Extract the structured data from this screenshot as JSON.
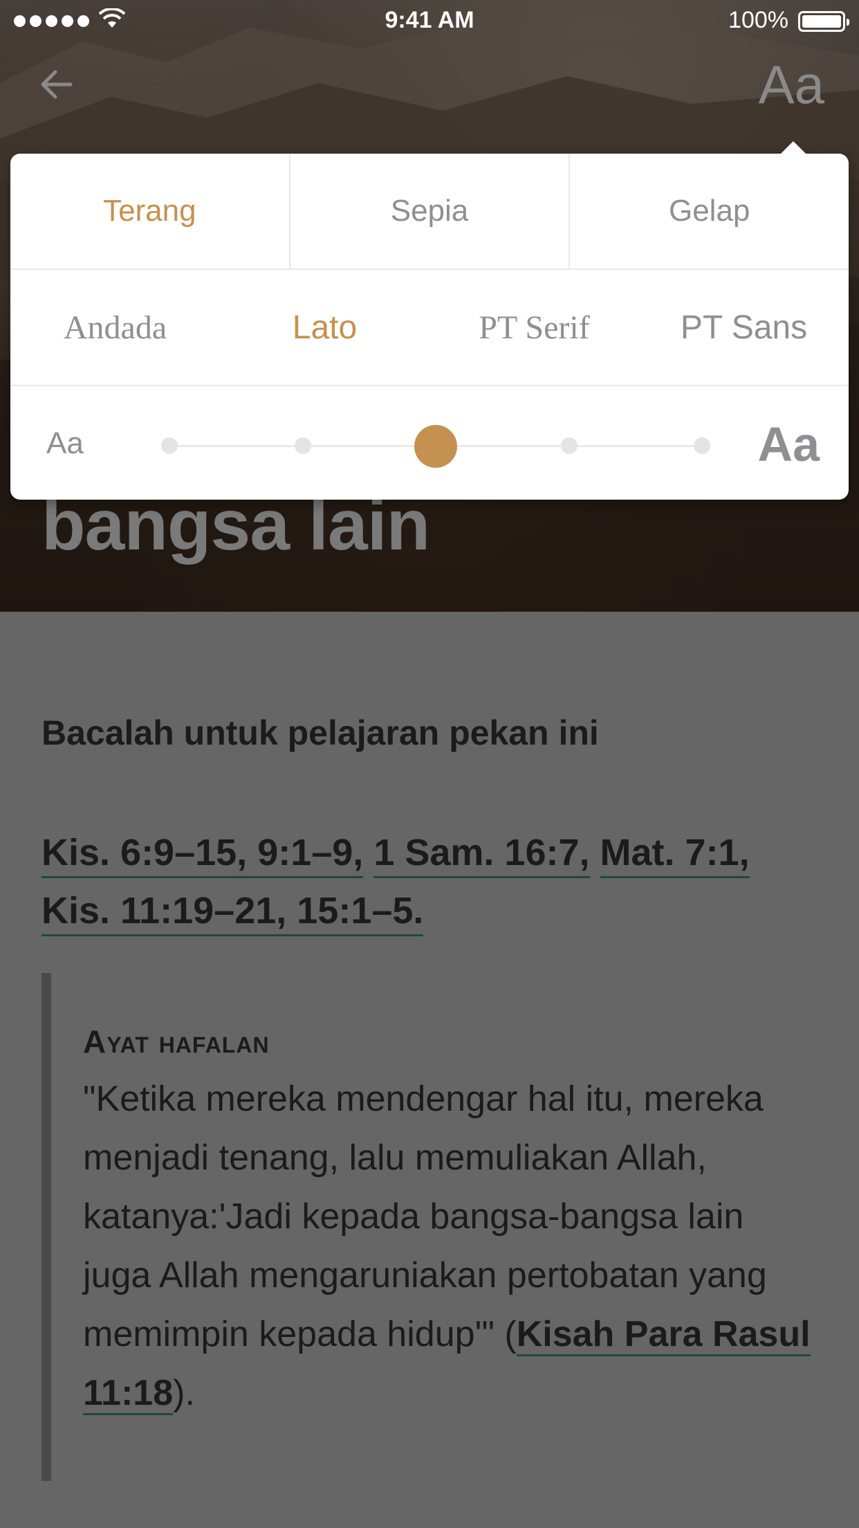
{
  "status_bar": {
    "time": "9:41 AM",
    "battery": "100%"
  },
  "nav": {
    "font_settings_label": "Aa"
  },
  "hero": {
    "title": "bangsa lain"
  },
  "panel": {
    "themes": [
      "Terang",
      "Sepia",
      "Gelap"
    ],
    "active_theme": "Terang",
    "fonts": [
      "Andada",
      "Lato",
      "PT Serif",
      "PT Sans"
    ],
    "active_font": "Lato",
    "size_small_label": "Aa",
    "size_large_label": "Aa",
    "size_steps": 5,
    "size_selected_step": 3
  },
  "content": {
    "heading": "Bacalah untuk pelajaran pekan ini",
    "references": [
      "Kis. 6:9–15, 9:1–9,",
      "1 Sam. 16:7,",
      "Mat. 7:1,",
      "Kis. 11:19–21, 15:1–5."
    ],
    "memory_verse": {
      "title": "Ayat hafalan",
      "text": "\"Ketika mereka mendengar hal itu, mereka menjadi tenang, lalu memuliakan Allah, katanya:'Jadi kepada bangsa-bangsa lain juga Allah mengaruniakan pertobatan yang memimpin kepada hidup'\" (",
      "reference": "Kisah Para Rasul 11:18",
      "closing": ")."
    }
  },
  "colors": {
    "accent": "#c49150",
    "overlay": "#666666",
    "link_underline": "#1e4a3a"
  }
}
